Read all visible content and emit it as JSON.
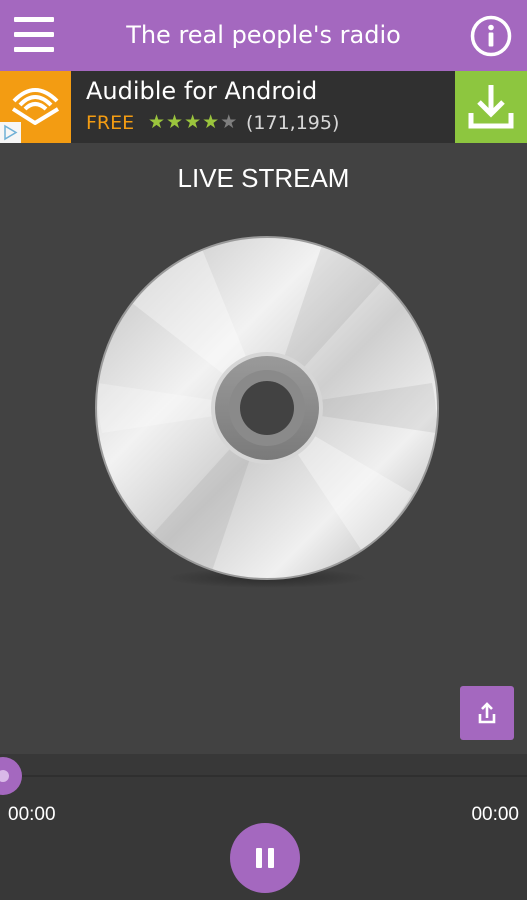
{
  "header": {
    "title": "The real people's radio",
    "menu_icon": "hamburger-menu-icon",
    "info_icon": "info-circle-icon"
  },
  "ad": {
    "app_name": "Audible for Android",
    "price": "FREE",
    "rating_stars": 4,
    "rating_max": 5,
    "rating_count": "(171,195)",
    "download_icon": "download-icon",
    "logo_icon": "audible-logo-icon",
    "adchoices_icon": "adchoices-icon"
  },
  "player": {
    "stream_label": "LIVE STREAM",
    "disc_icon": "cd-disc-icon",
    "share_icon": "share-icon",
    "progress": 0,
    "elapsed": "00:00",
    "duration": "00:00",
    "pause_icon": "pause-icon"
  },
  "colors": {
    "accent": "#a468bf",
    "background": "#424242",
    "ad_orange": "#f39c12",
    "ad_green": "#8dc63f",
    "star_green": "#9bc53d"
  }
}
